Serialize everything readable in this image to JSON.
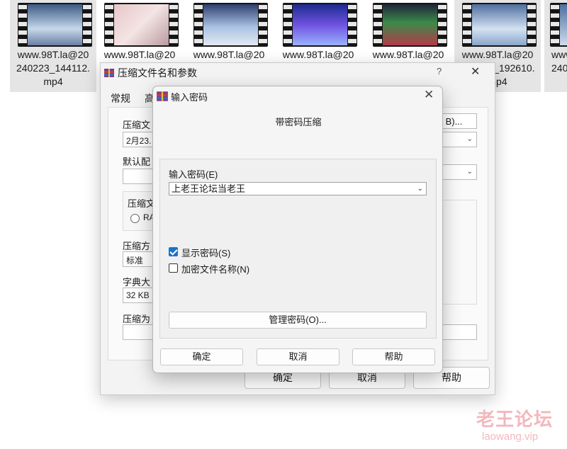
{
  "thumbnails": [
    {
      "caption": "www.98T.la@20\n240223_144112.\nmp4",
      "selected": true,
      "tint": "#8fb4d9"
    },
    {
      "caption": "www.98T.la@20",
      "selected": false,
      "tint": "#d9b3b3"
    },
    {
      "caption": "www.98T.la@20",
      "selected": false,
      "tint": "#7a9fd0"
    },
    {
      "caption": "www.98T.la@20",
      "selected": false,
      "tint": "#4a5fd8"
    },
    {
      "caption": "www.98T.la@20",
      "selected": false,
      "tint": "#3d3d6b"
    },
    {
      "caption": "www.98T.la@20\n240223_192610.\nmp4",
      "selected": true,
      "tint": "#9fc0e0"
    },
    {
      "caption": "www\n240",
      "selected": true,
      "tint": "#8fb4d9"
    }
  ],
  "archive_dialog": {
    "title": "压缩文件名和参数",
    "help_icon": "?",
    "close_icon": "✕",
    "tabs": [
      "常规",
      "高"
    ],
    "archive_name_label": "压缩文",
    "archive_name_value": "2月23.",
    "browse_button": "B)...",
    "default_profile_label": "默认配",
    "format_group_label": "压缩文",
    "rar_option": "RA",
    "method_label": "压缩方",
    "method_value": "标准",
    "dict_label": "字典大",
    "dict_value": "32 KB",
    "split_label": "压缩为",
    "ok": "确定",
    "cancel": "取消",
    "help": "帮助"
  },
  "password_dialog": {
    "title": "输入密码",
    "close_icon": "✕",
    "heading": "带密码压缩",
    "enter_password_label": "输入密码(E)",
    "password_value": "上老王论坛当老王",
    "show_password_label": "显示密码(S)",
    "show_password_checked": true,
    "encrypt_names_label": "加密文件名称(N)",
    "encrypt_names_checked": false,
    "manage_button": "管理密码(O)...",
    "ok": "确定",
    "cancel": "取消",
    "help": "帮助"
  },
  "watermark": {
    "name": "老王论坛",
    "url": "laowang.vip"
  }
}
